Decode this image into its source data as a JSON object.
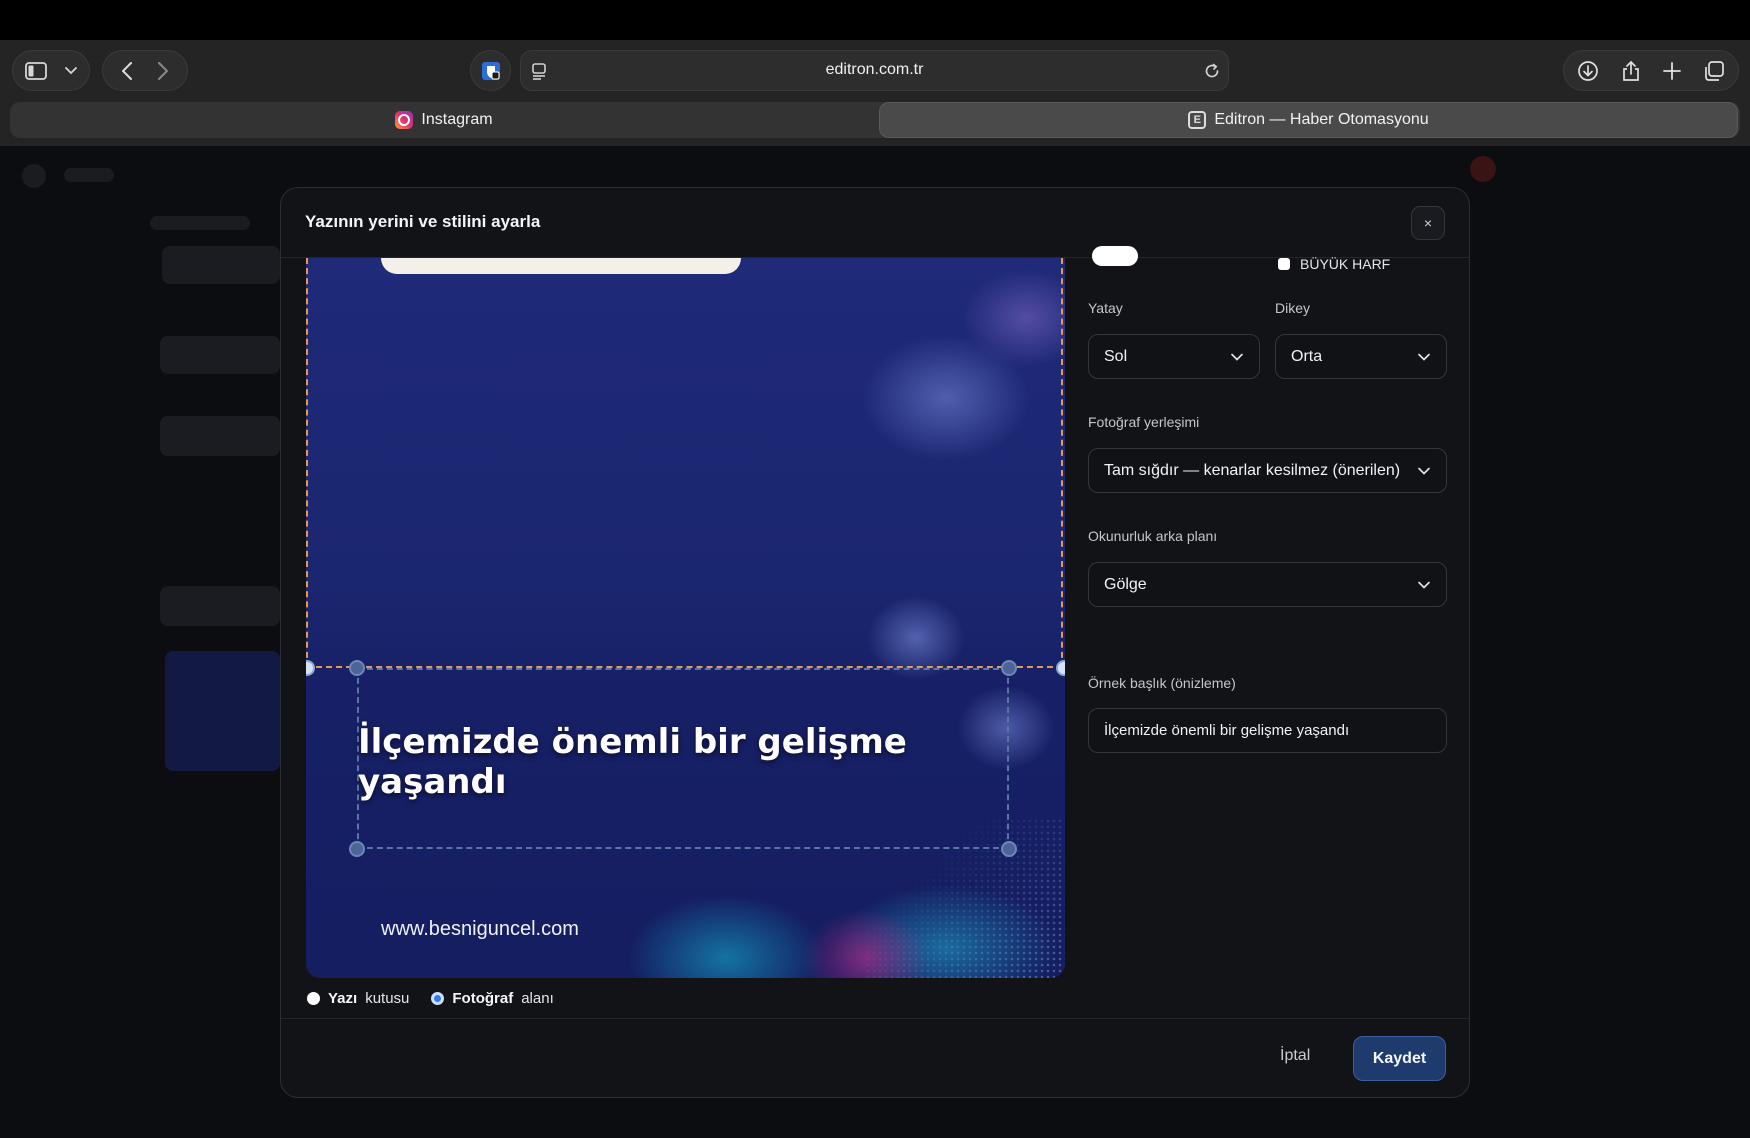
{
  "browser": {
    "url": "editron.com.tr",
    "tabs": [
      {
        "label": "Instagram",
        "icon": "instagram-icon"
      },
      {
        "label": "Editron — Haber Otomasyonu",
        "icon": "editron-icon",
        "active": true
      }
    ],
    "icons": [
      "sidebar-icon",
      "chevron-down-icon",
      "back-icon",
      "forward-icon",
      "privacy-shield-icon",
      "reader-icon",
      "reload-icon",
      "download-icon",
      "share-icon",
      "plus-icon",
      "tabs-overview-icon"
    ]
  },
  "modal": {
    "title": "Yazının yerini ve stilini ayarla",
    "close_label": "×",
    "preview": {
      "headline": "İlçemizde önemli bir gelişme yaşandı",
      "site_url": "www.besniguncel.com"
    },
    "edit_target": {
      "text_box": {
        "strong": "Yazı",
        "rest": "kutusu",
        "selected": false
      },
      "photo_area": {
        "strong": "Fotoğraf",
        "rest": "alanı",
        "selected": true
      }
    },
    "controls": {
      "uppercase_label": "BÜYÜK HARF",
      "horizontal_label": "Yatay",
      "horizontal_value": "Sol",
      "vertical_label": "Dikey",
      "vertical_value": "Orta",
      "photo_fit_label": "Fotoğraf yerleşimi",
      "photo_fit_value": "Tam sığdır — kenarlar kesilmez (önerilen)",
      "readability_label": "Okunurluk arka planı",
      "readability_value": "Gölge",
      "sample_title_label": "Örnek başlık (önizleme)",
      "sample_title_value": "İlçemizde önemli bir gelişme yaşandı"
    },
    "footer": {
      "cancel_label": "İptal",
      "save_label": "Kaydet"
    }
  },
  "colors": {
    "accent": "#2d7cf6",
    "save_button": "#1f3b6e",
    "photo_area_outline": "#e79a4a",
    "text_box_outline": "#5b74a8"
  }
}
